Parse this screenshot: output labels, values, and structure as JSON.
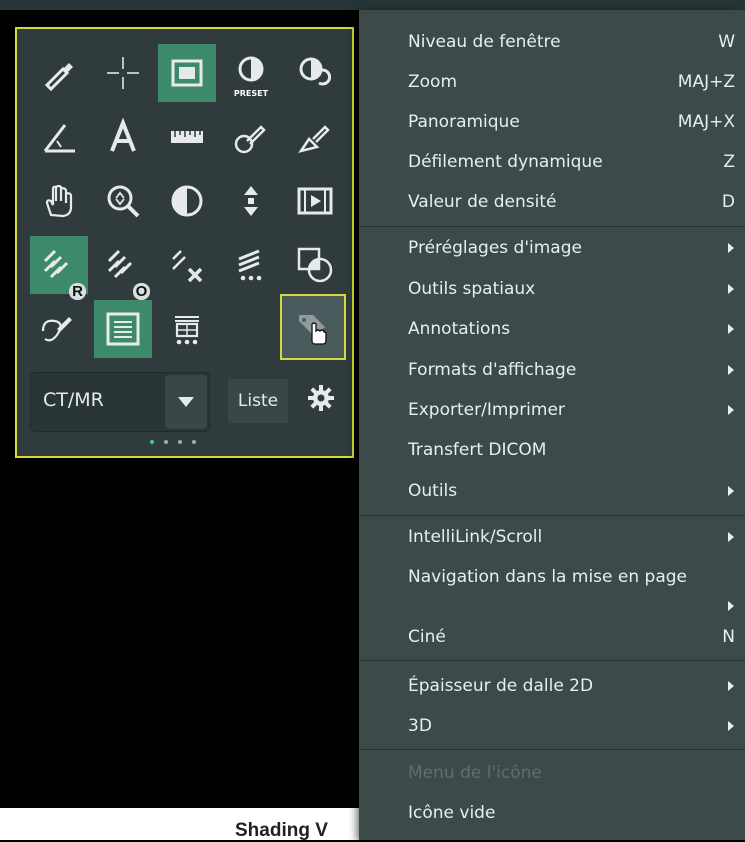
{
  "toolbox": {
    "badges": {
      "r": "R",
      "o": "O"
    },
    "preset_label": "PRESET",
    "mode_select": {
      "value": "CT/MR"
    },
    "list_button": "Liste"
  },
  "context_menu": {
    "items": [
      {
        "label": "Niveau de fenêtre",
        "shortcut": "W"
      },
      {
        "label": "Zoom",
        "shortcut": "MAJ+Z"
      },
      {
        "label": "Panoramique",
        "shortcut": "MAJ+X"
      },
      {
        "label": "Défilement dynamique",
        "shortcut": "Z"
      },
      {
        "label": "Valeur de densité",
        "shortcut": "D"
      },
      {
        "label": "Préréglages d'image",
        "shortcut": ""
      },
      {
        "label": "Outils spatiaux",
        "shortcut": ""
      },
      {
        "label": "Annotations",
        "shortcut": ""
      },
      {
        "label": "Formats d'affichage",
        "shortcut": ""
      },
      {
        "label": "Exporter/Imprimer",
        "shortcut": ""
      },
      {
        "label": "Transfert DICOM",
        "shortcut": ""
      },
      {
        "label": "Outils",
        "shortcut": ""
      },
      {
        "label": "IntelliLink/Scroll",
        "shortcut": ""
      },
      {
        "label": "Navigation dans la mise en page",
        "shortcut": ""
      },
      {
        "label": "Ciné",
        "shortcut": "N"
      },
      {
        "label": "Épaisseur de dalle 2D",
        "shortcut": ""
      },
      {
        "label": "3D",
        "shortcut": ""
      },
      {
        "label": "Menu de l'icône",
        "shortcut": ""
      },
      {
        "label": "Icône vide",
        "shortcut": ""
      }
    ]
  },
  "bottom_text": "Shading V",
  "colors": {
    "accent_yellow": "#d4da3d",
    "active_green": "#3d8a6a",
    "menu_bg": "#3c4a4a",
    "panel_bg": "#2f3b3d"
  }
}
